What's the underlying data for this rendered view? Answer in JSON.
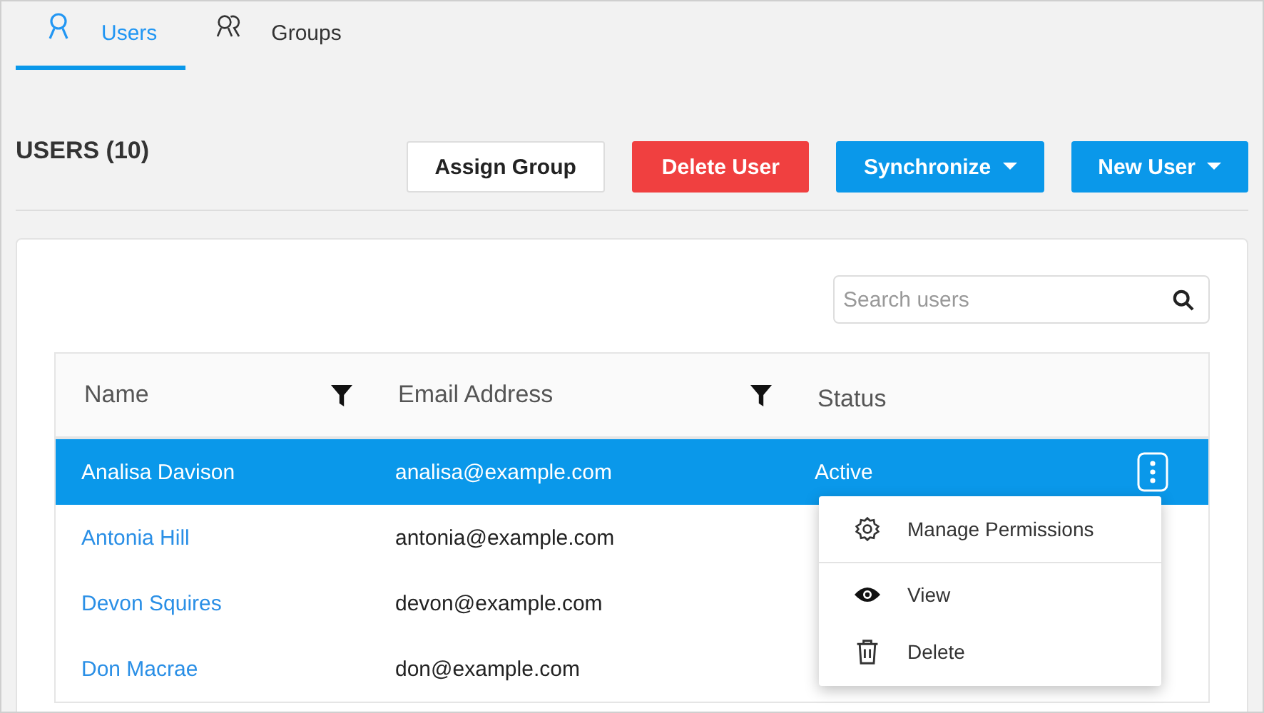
{
  "tabs": [
    {
      "label": "Users",
      "kind": "user",
      "selected": true
    },
    {
      "label": "Groups",
      "kind": "group",
      "selected": false
    }
  ],
  "heading": "USERS (10)",
  "buttons": [
    {
      "label": "Assign Group",
      "kind": "plain",
      "dropdown": false
    },
    {
      "label": "Delete User",
      "kind": "danger",
      "dropdown": false
    },
    {
      "label": "Synchronize",
      "kind": "primary",
      "dropdown": true
    },
    {
      "label": "New User",
      "kind": "primary",
      "dropdown": true
    }
  ],
  "search": {
    "placeholder": "Search users"
  },
  "table": {
    "columns": [
      {
        "label": "Name",
        "filter": true
      },
      {
        "label": "Email Address",
        "filter": true
      },
      {
        "label": "Status",
        "filter": false
      }
    ],
    "rows": [
      {
        "name": "Analisa Davison",
        "email": "analisa@example.com",
        "status": "Active",
        "selected": true
      },
      {
        "name": "Antonia Hill",
        "email": "antonia@example.com",
        "selected": false
      },
      {
        "name": "Devon Squires",
        "email": "devon@example.com",
        "selected": false
      },
      {
        "name": "Don Macrae",
        "email": "don@example.com",
        "selected": false
      }
    ]
  },
  "context_menu": [
    {
      "label": "Manage Permissions",
      "kind": "gear",
      "divider_after": true
    },
    {
      "label": "View",
      "kind": "eye",
      "divider_after": false
    },
    {
      "label": "Delete",
      "kind": "trash",
      "divider_after": false
    }
  ]
}
